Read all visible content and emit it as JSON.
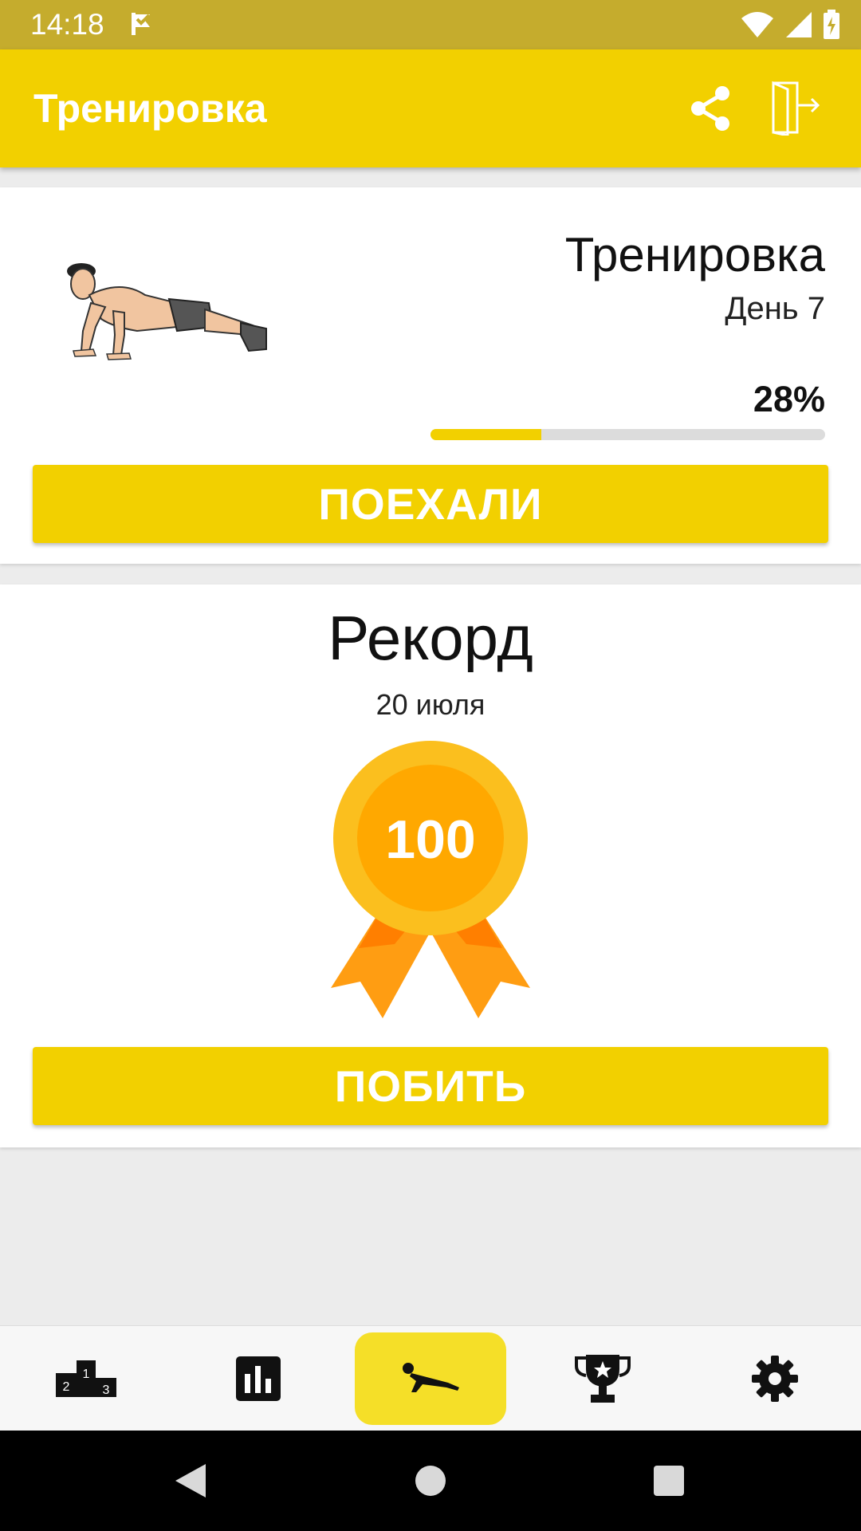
{
  "status_bar": {
    "time": "14:18",
    "icons": [
      "check-flag-icon",
      "wifi-icon",
      "signal-icon",
      "battery-icon"
    ]
  },
  "app_bar": {
    "title": "Тренировка",
    "actions": [
      "share-icon",
      "exit-icon"
    ]
  },
  "workout_card": {
    "title": "Тренировка",
    "day": "День 7",
    "progress_text": "28%",
    "progress_fraction": 0.28,
    "start_button": "ПОЕХАЛИ"
  },
  "record_card": {
    "title": "Рекорд",
    "date": "20 июля",
    "value": "100",
    "beat_button": "ПОБИТЬ"
  },
  "bottom_nav": {
    "items": [
      "podium-icon",
      "bar-chart-icon",
      "pushup-icon",
      "trophy-icon",
      "settings-icon"
    ],
    "active_index": 2
  },
  "colors": {
    "accent": "#f2d000",
    "status_bar": "#c5ac2d",
    "medal_outer": "#fbbf1e",
    "medal_inner": "#ffa800",
    "ribbon": "#ff9d12"
  }
}
